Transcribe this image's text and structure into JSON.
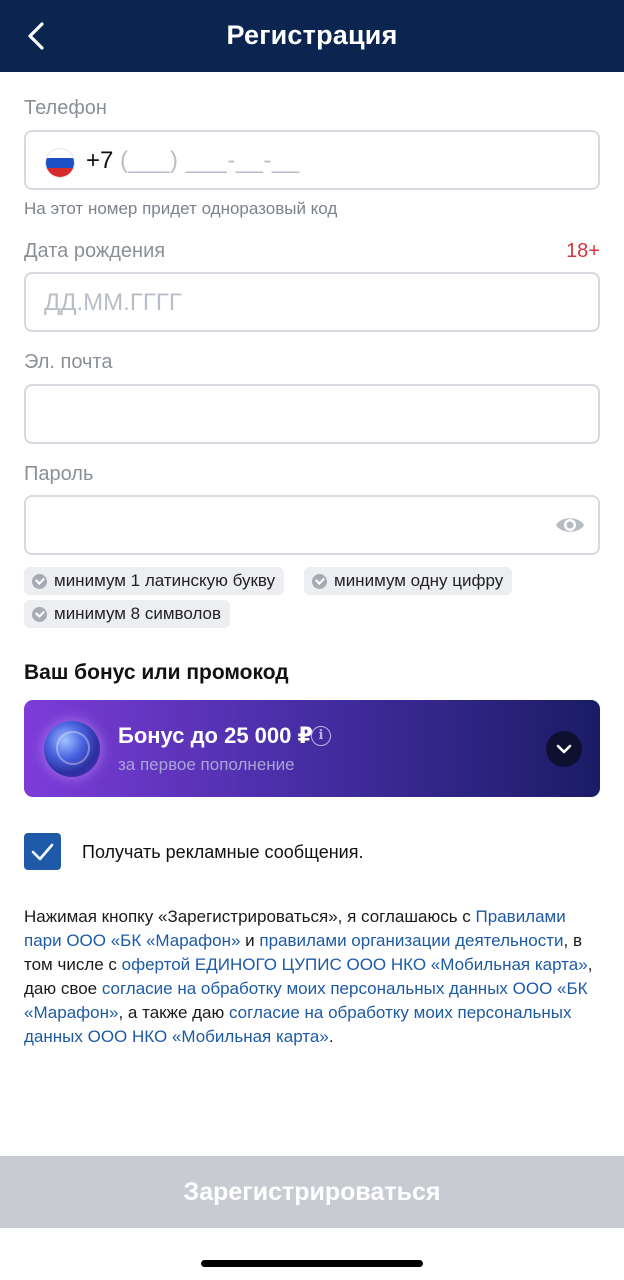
{
  "header": {
    "title": "Регистрация"
  },
  "phone": {
    "label": "Телефон",
    "prefix": "+7",
    "mask": "(___) ___-__-__",
    "hint": "На этот номер придет одноразовый код"
  },
  "birthdate": {
    "label": "Дата рождения",
    "age_badge": "18+",
    "placeholder": "ДД.ММ.ГГГГ"
  },
  "email": {
    "label": "Эл. почта"
  },
  "password": {
    "label": "Пароль",
    "requirements": [
      "минимум 1 латинскую букву",
      "минимум одну цифру",
      "минимум 8 символов"
    ]
  },
  "bonus": {
    "section_title": "Ваш бонус или промокод",
    "title": "Бонус до 25 000 ₽",
    "info_glyph": "i",
    "subtitle": "за первое пополнение"
  },
  "ads_checkbox": {
    "label": "Получать рекламные сообщения.",
    "checked": true
  },
  "terms": {
    "t1": "Нажимая кнопку «Зарегистрироваться», я соглашаюсь с ",
    "l1": "Правилами пари ООО «БК «Марафон»",
    "t2": " и ",
    "l2": "правилами организации деятельности",
    "t3": ", в том числе с ",
    "l3": "офертой ЕДИНОГО ЦУПИС ООО НКО «Мобильная карта»",
    "t4": ", даю свое ",
    "l4": "согласие на обработку моих персональных данных ООО «БК «Марафон»",
    "t5": ", а также даю ",
    "l5": "согласие на обработку моих персональных данных ООО НКО «Мобильная карта»",
    "t6": "."
  },
  "register_button": {
    "label": "Зарегистрироваться"
  },
  "colors": {
    "header_bg": "#0b2550",
    "link": "#1d5aa6",
    "age_badge": "#d23a3a",
    "checkbox": "#1e5aa8",
    "button_disabled": "#c8ccd2"
  }
}
